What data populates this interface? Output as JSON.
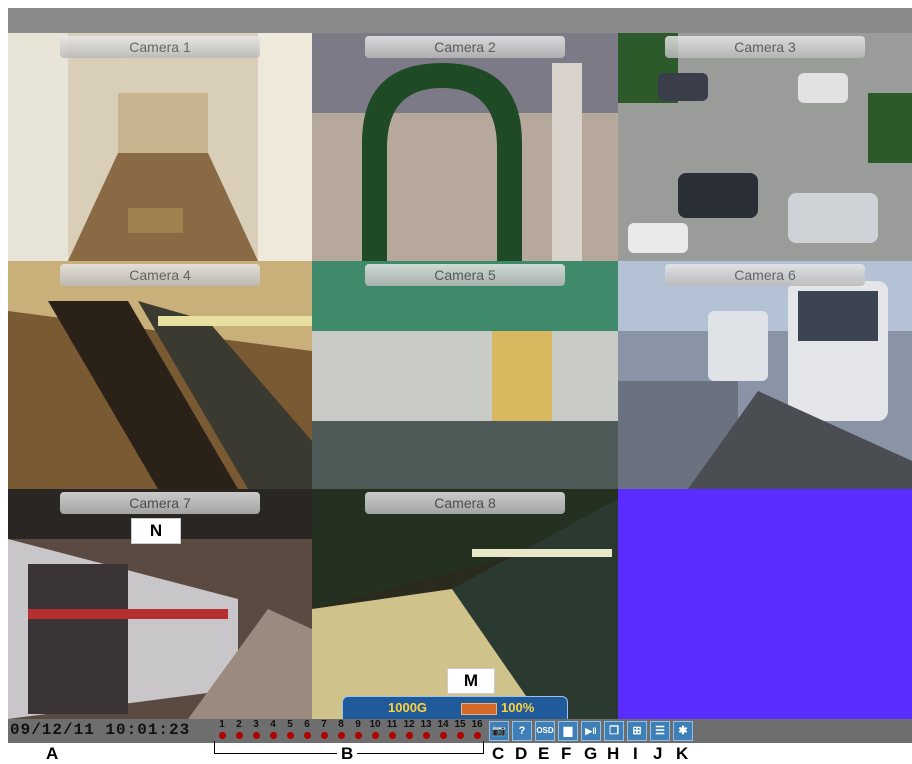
{
  "cameras": [
    {
      "label": "Camera 1"
    },
    {
      "label": "Camera 2"
    },
    {
      "label": "Camera 3"
    },
    {
      "label": "Camera 4"
    },
    {
      "label": "Camera 5"
    },
    {
      "label": "Camera 6"
    },
    {
      "label": "Camera 7"
    },
    {
      "label": "Camera 8"
    }
  ],
  "status": {
    "datetime": "09/12/11  10:01:23",
    "channels": [
      "1",
      "2",
      "3",
      "4",
      "5",
      "6",
      "7",
      "8",
      "9",
      "10",
      "11",
      "12",
      "13",
      "14",
      "15",
      "16"
    ],
    "hdd_size": "1000G",
    "hdd_percent": "100%",
    "tools": [
      {
        "icon": "camera-icon",
        "glyph": "📷"
      },
      {
        "icon": "help-icon",
        "glyph": "?"
      },
      {
        "icon": "osd-icon",
        "glyph": "OSD"
      },
      {
        "icon": "document-icon",
        "glyph": "▆"
      },
      {
        "icon": "play-pause-icon",
        "glyph": "▶‖"
      },
      {
        "icon": "window-icon",
        "glyph": "❐"
      },
      {
        "icon": "quad-grid-icon",
        "glyph": "⊞"
      },
      {
        "icon": "list-icon",
        "glyph": "☰"
      },
      {
        "icon": "snowflake-icon",
        "glyph": "✱"
      }
    ]
  },
  "callouts": {
    "n": "N",
    "m": "M"
  },
  "markers": {
    "a": "A",
    "b": "B",
    "c": "C",
    "d": "D",
    "e": "E",
    "f": "F",
    "g": "G",
    "h": "H",
    "i": "I",
    "j": "J",
    "k": "K"
  },
  "colors": {
    "blank_tile": "#5b2cff",
    "status_bar": "#6e6e6e",
    "accent": "#ffd23c"
  }
}
